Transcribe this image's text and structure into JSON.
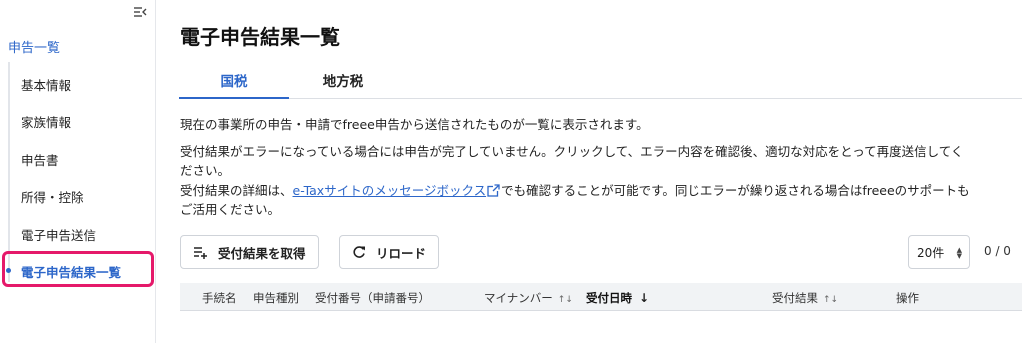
{
  "sidebar": {
    "parent_label": "申告一覧",
    "items": [
      {
        "label": "基本情報"
      },
      {
        "label": "家族情報"
      },
      {
        "label": "申告書"
      },
      {
        "label": "所得・控除"
      },
      {
        "label": "電子申告送信"
      },
      {
        "label": "電子申告結果一覧",
        "active": true
      }
    ],
    "highlight_color": "#e5196a",
    "accent_color": "#2c66c9"
  },
  "page": {
    "title": "電子申告結果一覧",
    "tabs": [
      {
        "label": "国税",
        "active": true
      },
      {
        "label": "地方税",
        "active": false
      }
    ],
    "description_line1": "現在の事業所の申告・申請でfreee申告から送信されたものが一覧に表示されます。",
    "description_line2": "受付結果がエラーになっている場合には申告が完了していません。クリックして、エラー内容を確認後、適切な対応をとって再度送信してく",
    "description_line3": "ださい。",
    "description_line4_prefix": "受付結果の詳細は、",
    "description_line4_link": "e-Taxサイトのメッセージボックス",
    "description_line4_suffix": "でも確認することが可能です。同じエラーが繰り返される場合はfreeeのサポートも",
    "description_line5": "ご活用ください。"
  },
  "toolbar": {
    "fetch_label": "受付結果を取得",
    "reload_label": "リロード",
    "page_size": "20件",
    "pager": "0 / 0"
  },
  "table": {
    "columns": [
      {
        "label": "手続名"
      },
      {
        "label": "申告種別"
      },
      {
        "label": "受付番号（申請番号）"
      },
      {
        "label": "マイナンバー",
        "sortable": true
      },
      {
        "label": "受付日時",
        "sorted": "desc"
      },
      {
        "label": "受付結果",
        "sortable": true
      },
      {
        "label": "操作"
      }
    ]
  },
  "icons": {
    "collapse": "sidebar-collapse-icon",
    "external": "external-link-icon",
    "fetch": "list-add-icon",
    "reload": "reload-icon"
  }
}
